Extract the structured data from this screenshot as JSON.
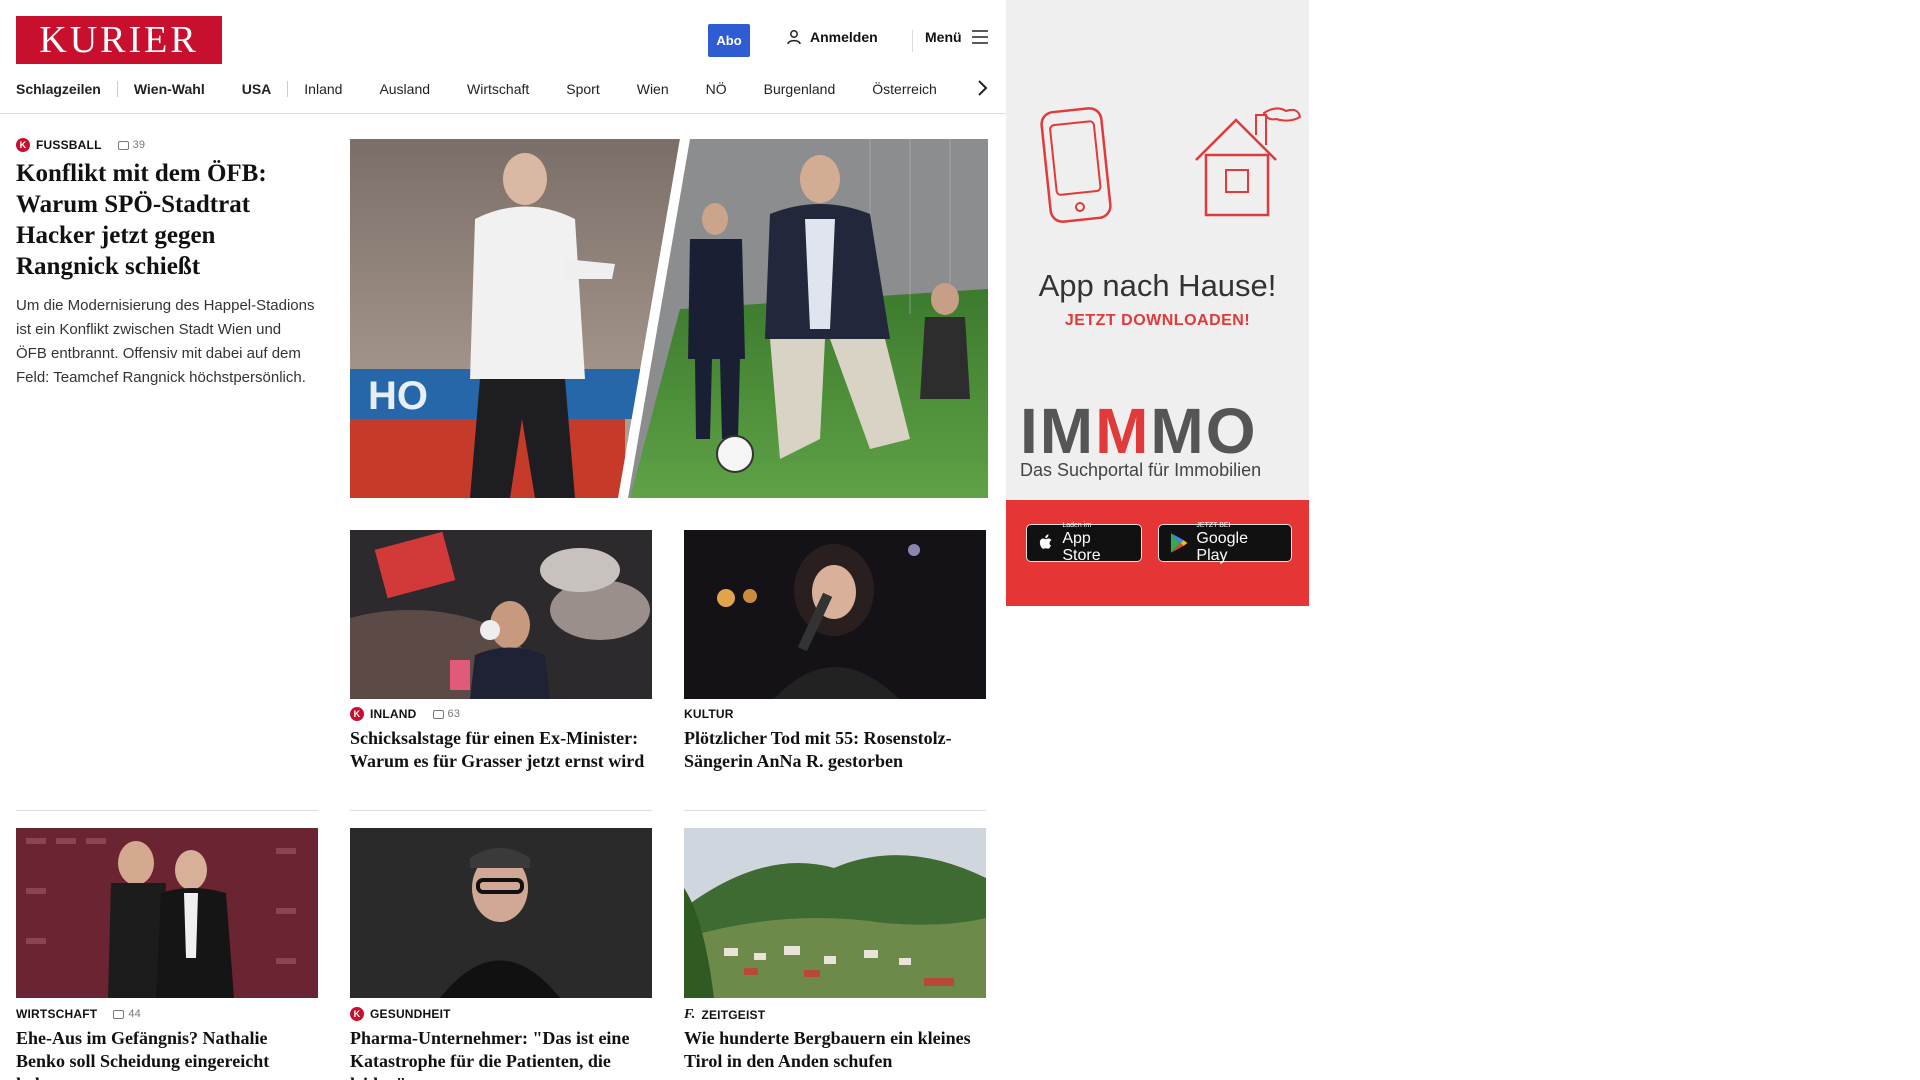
{
  "header": {
    "logo": "KURIER",
    "abo": "Abo",
    "login": "Anmelden",
    "menu": "Menü"
  },
  "nav": [
    "Schlagzeilen",
    "Wien-Wahl",
    "USA",
    "Inland",
    "Ausland",
    "Wirtschaft",
    "Sport",
    "Wien",
    "NÖ",
    "Burgenland",
    "Österreich"
  ],
  "hero": {
    "kicker": "FUSSBALL",
    "comments": "39",
    "headline": "Konflikt mit dem ÖFB: Warum SPÖ-Stadtrat Hacker jetzt gegen Rangnick schießt",
    "teaser": "Um die Modernisierung des Happel-Stadions ist ein Konflikt zwischen Stadt Wien und ÖFB entbrannt. Offensiv mit dabei auf dem Feld: Teamchef Rangnick höchstpersönlich."
  },
  "cards": [
    {
      "kicker": "INLAND",
      "comments": "63",
      "headline": "Schicksalstage für einen Ex-Minister: Warum es für Grasser jetzt ernst wird",
      "badge": "k"
    },
    {
      "kicker": "KULTUR",
      "comments": "",
      "headline": "Plötzlicher Tod mit 55: Rosenstolz-Sängerin AnNa R. gestorben",
      "badge": ""
    },
    {
      "kicker": "WIRTSCHAFT",
      "comments": "44",
      "headline": "Ehe-Aus im Gefängnis? Nathalie Benko soll Scheidung eingereicht haben",
      "badge": ""
    },
    {
      "kicker": "GESUNDHEIT",
      "comments": "",
      "headline": "Pharma-Unternehmer: \"Das ist eine Katastrophe für die Patienten, die leiden\"",
      "badge": "k"
    },
    {
      "kicker": "ZEITGEIST",
      "comments": "",
      "headline": "Wie hunderte Bergbauern ein kleines Tirol in den Anden schufen",
      "badge": "f"
    }
  ],
  "ad": {
    "title": "App nach Hause!",
    "subtitle": "JETZT DOWNLOADEN!",
    "brand_prefix": "IM",
    "brand_mid": "M",
    "brand_suffix": "MO",
    "brand_sub": "Das Suchportal für Immobilien",
    "appstore_small": "Laden im",
    "appstore_big": "App Store",
    "googleplay_small": "JETZT BEI",
    "googleplay_big": "Google Play"
  },
  "colors": {
    "brand": "#c8102e",
    "abo": "#2f5bd3",
    "ad_red": "#e53535"
  }
}
